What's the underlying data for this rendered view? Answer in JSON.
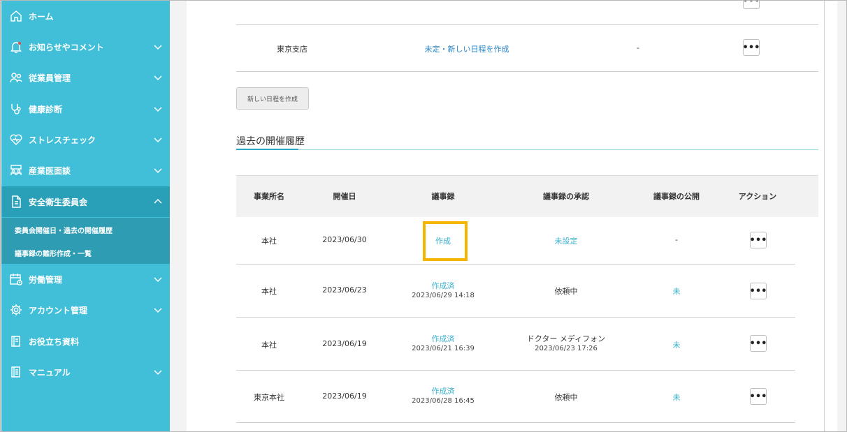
{
  "sidebar": {
    "items": [
      {
        "label": "ホーム",
        "icon": "home-icon"
      },
      {
        "label": "お知らせやコメント",
        "icon": "bell-icon"
      },
      {
        "label": "従業員管理",
        "icon": "people-icon"
      },
      {
        "label": "健康診断",
        "icon": "stethoscope-icon"
      },
      {
        "label": "ストレスチェック",
        "icon": "heart-icon"
      },
      {
        "label": "産業医面談",
        "icon": "meeting-icon"
      },
      {
        "label": "安全衛生委員会",
        "icon": "document-icon"
      },
      {
        "label": "労働管理",
        "icon": "calendar-clock-icon"
      },
      {
        "label": "アカウント管理",
        "icon": "gear-icon"
      },
      {
        "label": "お役立ち資料",
        "icon": "book-icon"
      },
      {
        "label": "マニュアル",
        "icon": "manual-icon"
      }
    ],
    "sub_items": [
      {
        "label": "委員会開催日・過去の開催履歴"
      },
      {
        "label": "議事録の雛形作成・一覧"
      }
    ]
  },
  "top_table": {
    "rows": [
      {
        "office": "東京支店",
        "link": "未定・新しい日程を作成",
        "value": "-"
      }
    ]
  },
  "new_schedule_button": "新しい日程を作成",
  "history": {
    "title": "過去の開催履歴",
    "headers": [
      "事業所名",
      "開催日",
      "議事録",
      "議事録の承認",
      "議事録の公開",
      "アクション"
    ],
    "rows": [
      {
        "office": "本社",
        "date": "2023/06/30",
        "minutes": "作成",
        "minutes_date": "",
        "approval": "未設定",
        "approval_date": "",
        "publish": "-"
      },
      {
        "office": "本社",
        "date": "2023/06/23",
        "minutes": "作成済",
        "minutes_date": "2023/06/29 14:18",
        "approval": "依頼中",
        "approval_date": "",
        "publish": "未"
      },
      {
        "office": "本社",
        "date": "2023/06/19",
        "minutes": "作成済",
        "minutes_date": "2023/06/21 16:39",
        "approval": "ドクター メディフォン",
        "approval_date": "2023/06/23 17:26",
        "publish": "未"
      },
      {
        "office": "東京本社",
        "date": "2023/06/19",
        "minutes": "作成済",
        "minutes_date": "2023/06/28 16:45",
        "approval": "依頼中",
        "approval_date": "",
        "publish": "未"
      }
    ],
    "action_label": "•••"
  },
  "colors": {
    "sidebar": "#41bfd9",
    "sidebar_active": "#2aa0b8",
    "link": "#2b87c7",
    "teal_text": "#3ab0cc",
    "highlight": "#f5b400"
  }
}
